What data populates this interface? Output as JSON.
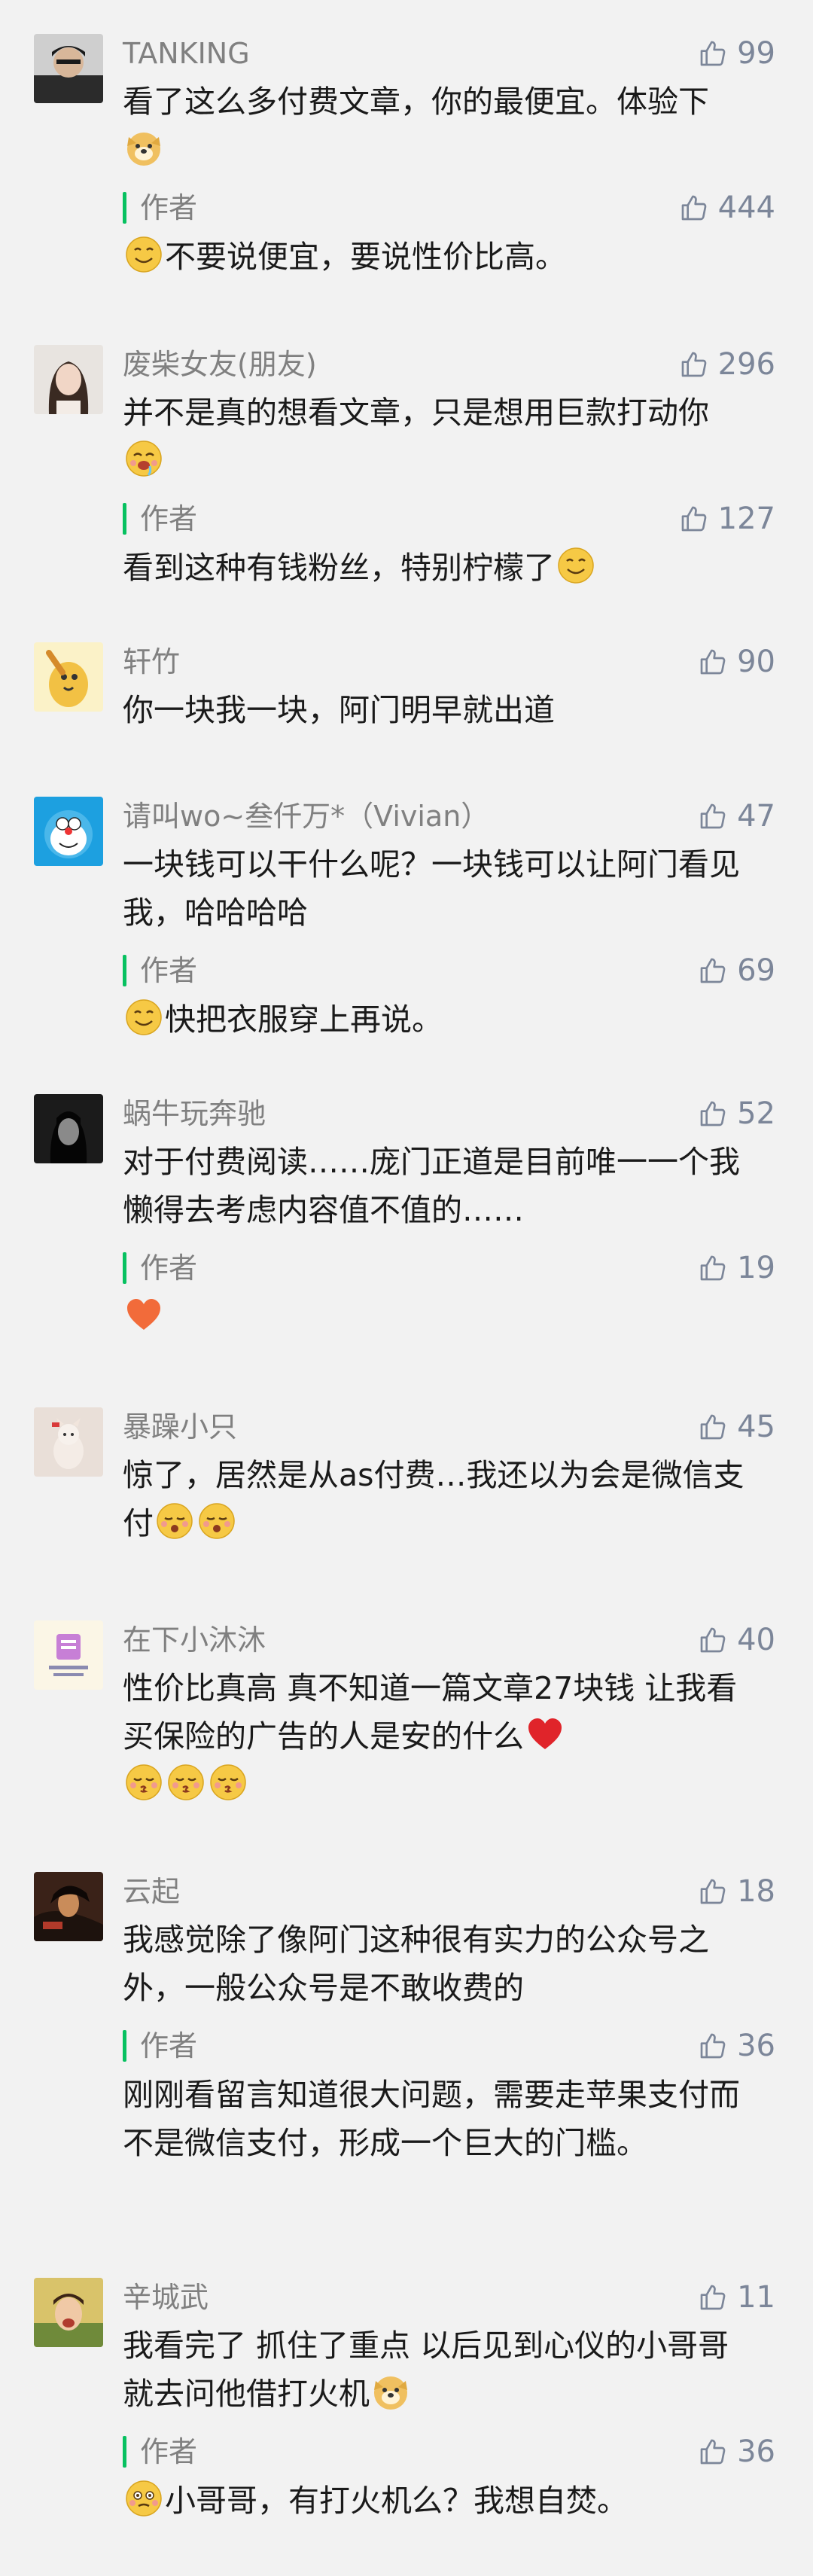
{
  "comments": [
    {
      "nickname": "TANKING",
      "likes": "99",
      "text_parts": [
        "看了这么多付费文章，你的最便宜。体验下"
      ],
      "text_emoji": [
        "doge-emoji"
      ],
      "reply": {
        "label": "作者",
        "likes": "444",
        "text": "不要说便宜，要说性价比高。",
        "emoji_lead": "smile-emoji"
      }
    },
    {
      "nickname": "废柴女友(朋友)",
      "likes": "296",
      "text_parts": [
        "并不是真的想看文章，只是想用巨款打动你"
      ],
      "text_emoji": [
        "drool-emoji"
      ],
      "reply": {
        "label": "作者",
        "likes": "127",
        "text": "看到这种有钱粉丝，特别柠檬了",
        "emoji_trail": "smile-emoji"
      }
    },
    {
      "nickname": "轩竹",
      "likes": "90",
      "text_parts": [
        "你一块我一块，阿门明早就出道"
      ]
    },
    {
      "nickname": "请叫wo~叁仟万*（Vivian）",
      "likes": "47",
      "text_parts": [
        "一块钱可以干什么呢？一块钱可以让阿门看见我，哈哈哈哈"
      ],
      "reply": {
        "label": "作者",
        "likes": "69",
        "text": "快把衣服穿上再说。",
        "emoji_lead": "smile-emoji"
      }
    },
    {
      "nickname": "蜗牛玩奔驰",
      "likes": "52",
      "text_parts": [
        "对于付费阅读……庞门正道是目前唯一一个我懒得去考虑内容值不值的……"
      ],
      "reply": {
        "label": "作者",
        "likes": "19",
        "text": "",
        "emoji_lead": "heart-orange-emoji"
      }
    },
    {
      "nickname": "暴躁小只",
      "likes": "45",
      "text_parts": [
        "惊了，居然是从as付费…我还以为会是微信支付"
      ],
      "text_emoji": [
        "shy-emoji",
        "shy-emoji"
      ]
    },
    {
      "nickname": "在下小沐沐",
      "likes": "40",
      "text_parts": [
        "性价比真高 真不知道一篇文章27块钱 让我看买保险的广告的人是安的什么"
      ],
      "text_emoji": [
        "heart-red-emoji",
        "kiss-emoji",
        "kiss-emoji",
        "kiss-emoji"
      ]
    },
    {
      "nickname": "云起",
      "likes": "18",
      "text_parts": [
        "我感觉除了像阿门这种很有实力的公众号之外，一般公众号是不敢收费的"
      ],
      "reply": {
        "label": "作者",
        "likes": "36",
        "text": "刚刚看留言知道很大问题，需要走苹果支付而不是微信支付，形成一个巨大的门槛。"
      }
    },
    {
      "nickname": "辛城武",
      "likes": "11",
      "text_parts": [
        "我看完了 抓住了重点 以后见到心仪的小哥哥就去问他借打火机"
      ],
      "text_emoji": [
        "doge-emoji"
      ],
      "reply": {
        "label": "作者",
        "likes": "36",
        "text": "小哥哥，有打火机么？我想自焚。",
        "emoji_lead": "flush-emoji"
      }
    }
  ],
  "colors": {
    "background": "#f2f2f2",
    "nickname": "#808080",
    "text": "#1a1a1a",
    "like_count": "#7c8699",
    "author_bar": "#07c160"
  }
}
